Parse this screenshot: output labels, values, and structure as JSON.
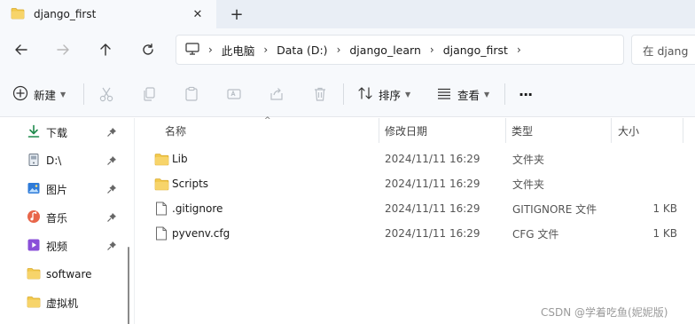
{
  "tab": {
    "title": "django_first"
  },
  "breadcrumb": [
    "此电脑",
    "Data (D:)",
    "django_learn",
    "django_first"
  ],
  "search": {
    "placeholder": "在 djang"
  },
  "commands": {
    "new_label": "新建",
    "sort_label": "排序",
    "view_label": "查看",
    "more_label": "···"
  },
  "sidebar": {
    "items": [
      {
        "label": "下载",
        "icon": "download-icon",
        "pinned": true
      },
      {
        "label": "D:\\",
        "icon": "drive-icon",
        "pinned": true
      },
      {
        "label": "图片",
        "icon": "pictures-icon",
        "pinned": true
      },
      {
        "label": "音乐",
        "icon": "music-icon",
        "pinned": true
      },
      {
        "label": "视频",
        "icon": "video-icon",
        "pinned": true
      },
      {
        "label": "software",
        "icon": "folder-icon",
        "pinned": false
      },
      {
        "label": "虚拟机",
        "icon": "folder-icon",
        "pinned": false
      }
    ]
  },
  "columns": {
    "name": "名称",
    "modified": "修改日期",
    "type": "类型",
    "size": "大小"
  },
  "files": [
    {
      "name": "Lib",
      "modified": "2024/11/11 16:29",
      "type": "文件夹",
      "size": "",
      "icon": "folder-icon"
    },
    {
      "name": "Scripts",
      "modified": "2024/11/11 16:29",
      "type": "文件夹",
      "size": "",
      "icon": "folder-icon"
    },
    {
      "name": ".gitignore",
      "modified": "2024/11/11 16:29",
      "type": "GITIGNORE 文件",
      "size": "1 KB",
      "icon": "file-icon"
    },
    {
      "name": "pyvenv.cfg",
      "modified": "2024/11/11 16:29",
      "type": "CFG 文件",
      "size": "1 KB",
      "icon": "file-icon"
    }
  ],
  "watermark": "CSDN @学着吃鱼(妮妮版)",
  "colors": {
    "folder": "#f2c94c",
    "accent": "#0067c0"
  }
}
